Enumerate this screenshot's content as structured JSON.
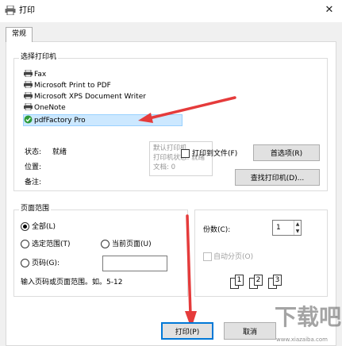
{
  "window": {
    "title": "打印",
    "close_glyph": "✕"
  },
  "tabs": [
    {
      "label": "常规",
      "selected": true
    }
  ],
  "select_printer": {
    "title": "选择打印机",
    "printers": [
      {
        "name": "Fax",
        "icon": "fax-printer-icon"
      },
      {
        "name": "Microsoft Print to PDF",
        "icon": "printer-icon"
      },
      {
        "name": "Microsoft XPS Document Writer",
        "icon": "printer-icon"
      },
      {
        "name": "OneNote",
        "icon": "printer-icon"
      },
      {
        "name": "pdfFactory Pro",
        "icon": "default-printer-check-icon",
        "selected": true
      }
    ],
    "status_label": "状态:",
    "status_value": "就绪",
    "location_label": "位置:",
    "comment_label": "备注:",
    "print_to_file_label": "打印到文件(F)",
    "print_to_file_checked": false,
    "preferences_button": "首选项(R)",
    "find_printer_button": "查找打印机(D)...",
    "tooltip_lines": [
      "默认打印机",
      "打印机状态: 就绪",
      "文档: 0"
    ]
  },
  "page_range": {
    "title": "页面范围",
    "all_label": "全部(L)",
    "selection_label": "选定范围(T)",
    "current_page_label": "当前页面(U)",
    "pages_label": "页码(G):",
    "pages_value": "",
    "hint": "输入页码或页面范围。如。5-12",
    "selected_option": "all"
  },
  "copies": {
    "label": "份数(C):",
    "value": "1",
    "collate_label": "自动分页(O)",
    "collate_enabled": false,
    "collate_pages": [
      "1",
      "1",
      "2",
      "2",
      "3",
      "3"
    ]
  },
  "footer": {
    "print_button": "打印(P)",
    "cancel_button": "取消"
  },
  "watermark": {
    "text": "下载吧",
    "url": "www.xiazaiba.com"
  },
  "colors": {
    "accent": "#0078d7",
    "annotation_arrow": "#e53b3b",
    "selection": "#cce8ff"
  }
}
